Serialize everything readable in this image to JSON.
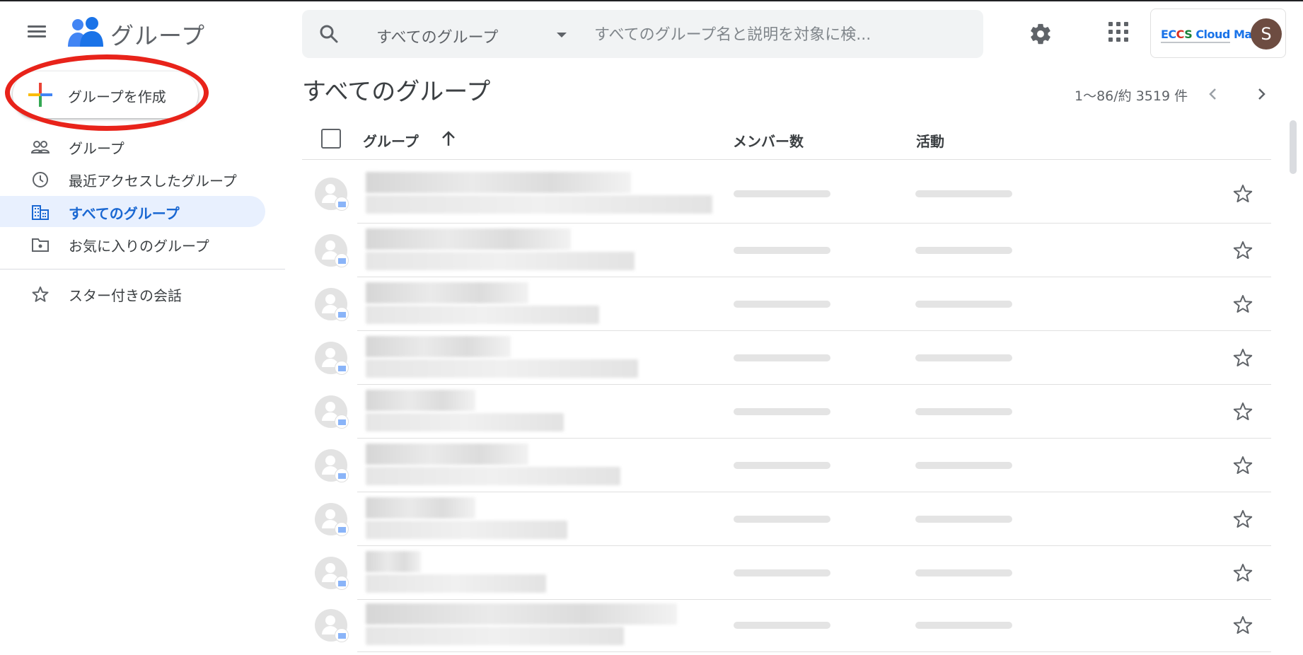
{
  "app": {
    "name": "グループ"
  },
  "search": {
    "scope": "すべてのグループ",
    "placeholder": "すべてのグループ名と説明を対象に検..."
  },
  "account": {
    "org_logo_parts": [
      "EC",
      "C",
      "S ",
      "Cloud Mail"
    ],
    "avatar_letter": "S",
    "avatar_color": "#6d4c41"
  },
  "sidebar": {
    "create_label": "グループを作成",
    "items": [
      {
        "label": "グループ",
        "icon": "people-outline-icon"
      },
      {
        "label": "最近アクセスしたグループ",
        "icon": "clock-icon"
      },
      {
        "label": "すべてのグループ",
        "icon": "domain-icon",
        "active": true
      },
      {
        "label": "お気に入りのグループ",
        "icon": "folder-star-icon"
      },
      {
        "label": "スター付きの会話",
        "icon": "star-outline-icon"
      }
    ]
  },
  "main": {
    "title": "すべてのグループ",
    "pagination": "1～86/約 3519 件",
    "columns": {
      "group": "グループ",
      "members": "メンバー数",
      "activity": "活動"
    },
    "row_count": 9
  },
  "colors": {
    "accent": "#1967d2",
    "active_bg": "#e8f0fe",
    "annotation": "#e8231a",
    "plus": [
      "#ea4335",
      "#fbbc04",
      "#34a853",
      "#4285f4"
    ]
  }
}
